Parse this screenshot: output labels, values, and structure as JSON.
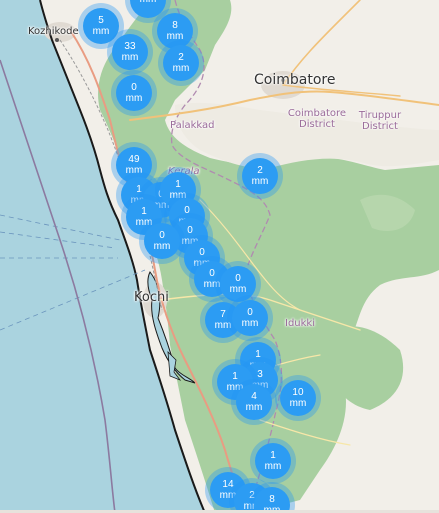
{
  "map": {
    "colors": {
      "sea": "#aad3df",
      "land": "#f2efe9",
      "forest": "#a8cfa0",
      "marker": "#2c9cf3"
    },
    "labels": {
      "kozhikode": "Kozhikode",
      "coimbatore": "Coimbatore",
      "coimbatore_district_1": "Coimbatore",
      "coimbatore_district_2": "District",
      "tiruppur_district_1": "Tiruppur",
      "tiruppur_district_2": "District",
      "palakkad": "Palakkad",
      "kerala": "Kerala",
      "kochi": "Kochi",
      "idukki": "Idukki"
    }
  },
  "markers": [
    {
      "value": "5",
      "unit": "mm"
    },
    {
      "value": "",
      "unit": "mm"
    },
    {
      "value": "8",
      "unit": "mm"
    },
    {
      "value": "33",
      "unit": "mm"
    },
    {
      "value": "2",
      "unit": "mm"
    },
    {
      "value": "0",
      "unit": "mm"
    },
    {
      "value": "49",
      "unit": "mm"
    },
    {
      "value": "2",
      "unit": "mm"
    },
    {
      "value": "1",
      "unit": "mm"
    },
    {
      "value": "0",
      "unit": "mm"
    },
    {
      "value": "1",
      "unit": "mm"
    },
    {
      "value": "0",
      "unit": "mm"
    },
    {
      "value": "1",
      "unit": "mm"
    },
    {
      "value": "0",
      "unit": "mm"
    },
    {
      "value": "0",
      "unit": "mm"
    },
    {
      "value": "0",
      "unit": "mm"
    },
    {
      "value": "0",
      "unit": "mm"
    },
    {
      "value": "0",
      "unit": "mm"
    },
    {
      "value": "7",
      "unit": "mm"
    },
    {
      "value": "0",
      "unit": "mm"
    },
    {
      "value": "1",
      "unit": "mm"
    },
    {
      "value": "3",
      "unit": "mm"
    },
    {
      "value": "1",
      "unit": "mm"
    },
    {
      "value": "4",
      "unit": "mm"
    },
    {
      "value": "10",
      "unit": "mm"
    },
    {
      "value": "1",
      "unit": "mm"
    },
    {
      "value": "14",
      "unit": "mm"
    },
    {
      "value": "2",
      "unit": "mm"
    },
    {
      "value": "8",
      "unit": "mm"
    }
  ]
}
